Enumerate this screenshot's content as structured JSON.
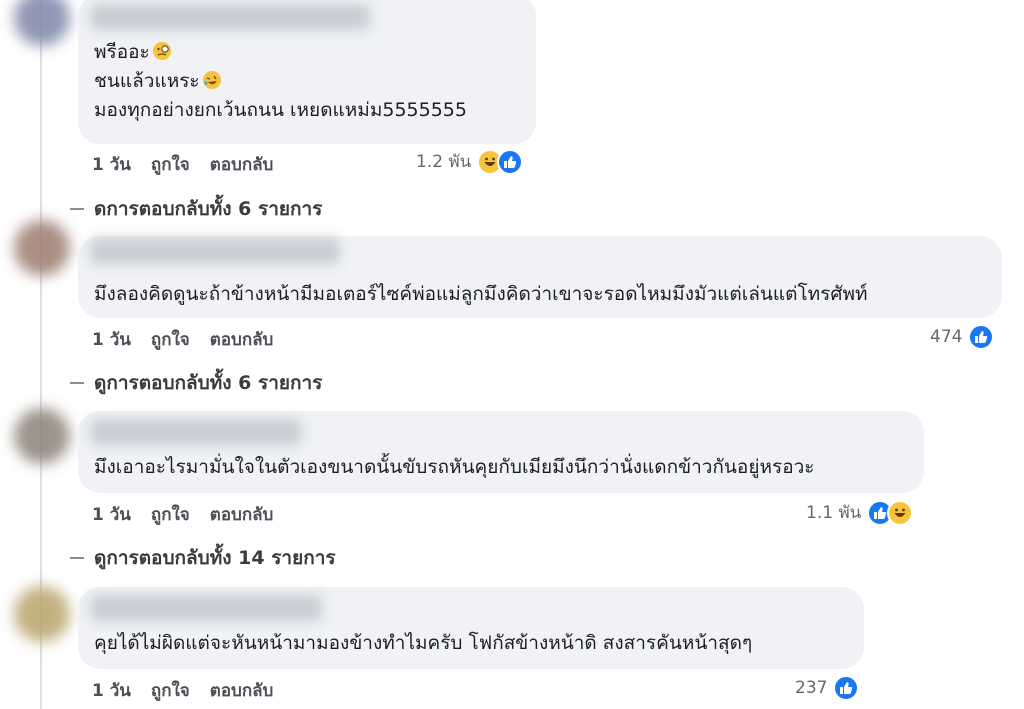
{
  "comments": [
    {
      "lines": [
        "พรีออะ",
        "ชนแล้วแหระ",
        "มองทุกอย่างยกเว้นถนน เหยดแหม่ม5555555"
      ],
      "time": "1 วัน",
      "like_label": "ถูกใจ",
      "reply_label": "ตอบกลับ",
      "reaction_count": "1.2 พัน",
      "reactions": [
        "haha-icon",
        "like-icon"
      ]
    },
    {
      "lines": [
        "มึงลองคิดดูนะถ้าข้างหน้ามีมอเตอร์ไซค์พ่อแม่ลูกมึงคิดว่าเขาจะรอดไหมมึงมัวแต่เล่นแต่โทรศัพท์"
      ],
      "time": "1 วัน",
      "like_label": "ถูกใจ",
      "reply_label": "ตอบกลับ",
      "reaction_count": "474",
      "reactions": [
        "like-icon"
      ]
    },
    {
      "lines": [
        "มึงเอาอะไรมามั่นใจในตัวเองขนาดนั้นขับรถหันคุยกับเมียมึงนึกว่านั่งแดกข้าวกันอยู่หรอวะ"
      ],
      "time": "1 วัน",
      "like_label": "ถูกใจ",
      "reply_label": "ตอบกลับ",
      "reaction_count": "1.1 พัน",
      "reactions": [
        "like-icon",
        "haha-icon"
      ]
    },
    {
      "lines": [
        "คุยได้ไม่ผิดแต่จะหันหน้ามามองข้างทำไมครับ โฟกัสข้างหน้าดิ สงสารคันหน้าสุดๆ"
      ],
      "time": "1 วัน",
      "like_label": "ถูกใจ",
      "reply_label": "ตอบกลับ",
      "reaction_count": "237",
      "reactions": [
        "like-icon"
      ]
    }
  ],
  "view_replies": [
    "ดการตอบกลับทั้ง 6 รายการ",
    "ดูการตอบกลับทั้ง 6 รายการ",
    "ดูการตอบกลับทั้ง 14 รายการ"
  ],
  "colors": {
    "bubble": "#f0f2f5",
    "like_blue": "#1877f2",
    "haha_yellow": "#f7c33b"
  }
}
